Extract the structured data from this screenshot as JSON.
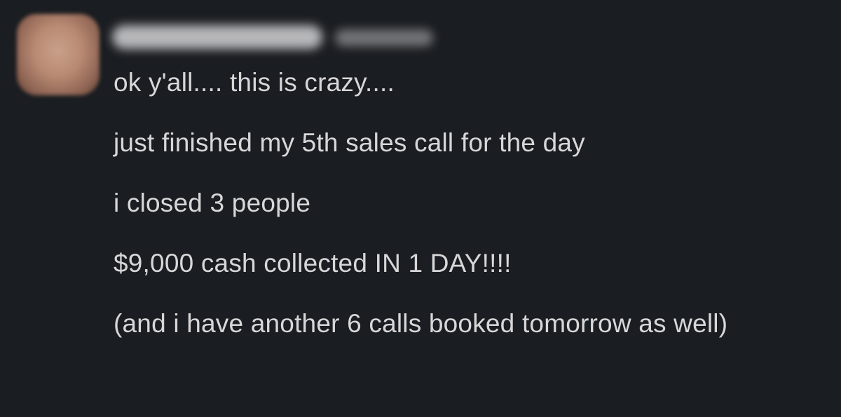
{
  "message": {
    "lines": [
      "ok y'all.... this is crazy....",
      "just finished my 5th sales call for the day",
      "i closed 3 people",
      "$9,000 cash collected IN 1 DAY!!!!",
      "(and i have another 6 calls booked tomorrow as well)"
    ]
  },
  "colors": {
    "background": "#1a1d21",
    "text": "#d7d7d8"
  }
}
